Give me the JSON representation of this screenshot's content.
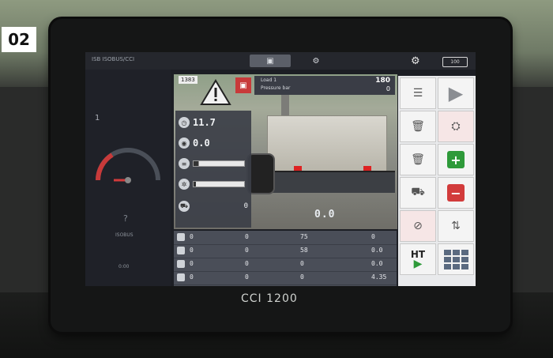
{
  "badge": "02",
  "brand": "CCI 1200",
  "status": {
    "title": "ISB  ISOBUS/CCI"
  },
  "tabs": {
    "camera": "▣",
    "tools": "⚙"
  },
  "battery": "100",
  "gauge": {
    "number": "1",
    "question": "?",
    "label1": "ISOBUS",
    "label2": "0:00"
  },
  "warning": {
    "counter": "1383"
  },
  "topbar": {
    "line1": "Load  1",
    "line2": "Pressure  bar",
    "right1": "180",
    "right2": "0"
  },
  "datapanel": {
    "speed": "11.7",
    "rate": "0.0",
    "bar1_fill": 0.1,
    "bar2_fill": 0.05,
    "row5_value": "0"
  },
  "camera": {
    "value": "0.0"
  },
  "table": {
    "rows": [
      {
        "c1": "0",
        "c2": "0",
        "c3": "75",
        "c4": "0"
      },
      {
        "c1": "0",
        "c2": "0",
        "c3": "58",
        "c4": "0.0"
      },
      {
        "c1": "0",
        "c2": "0",
        "c3": "0",
        "c4": "0.0"
      },
      {
        "c1": "0",
        "c2": "0",
        "c3": "0",
        "c4": "4.35"
      }
    ]
  },
  "rightcol": {
    "ht_label": "HT",
    "play": "▶"
  },
  "colors": {
    "screen_bg": "#1c1e24",
    "accent_red": "#c83a3a",
    "accent_green": "#2e9a3a"
  }
}
